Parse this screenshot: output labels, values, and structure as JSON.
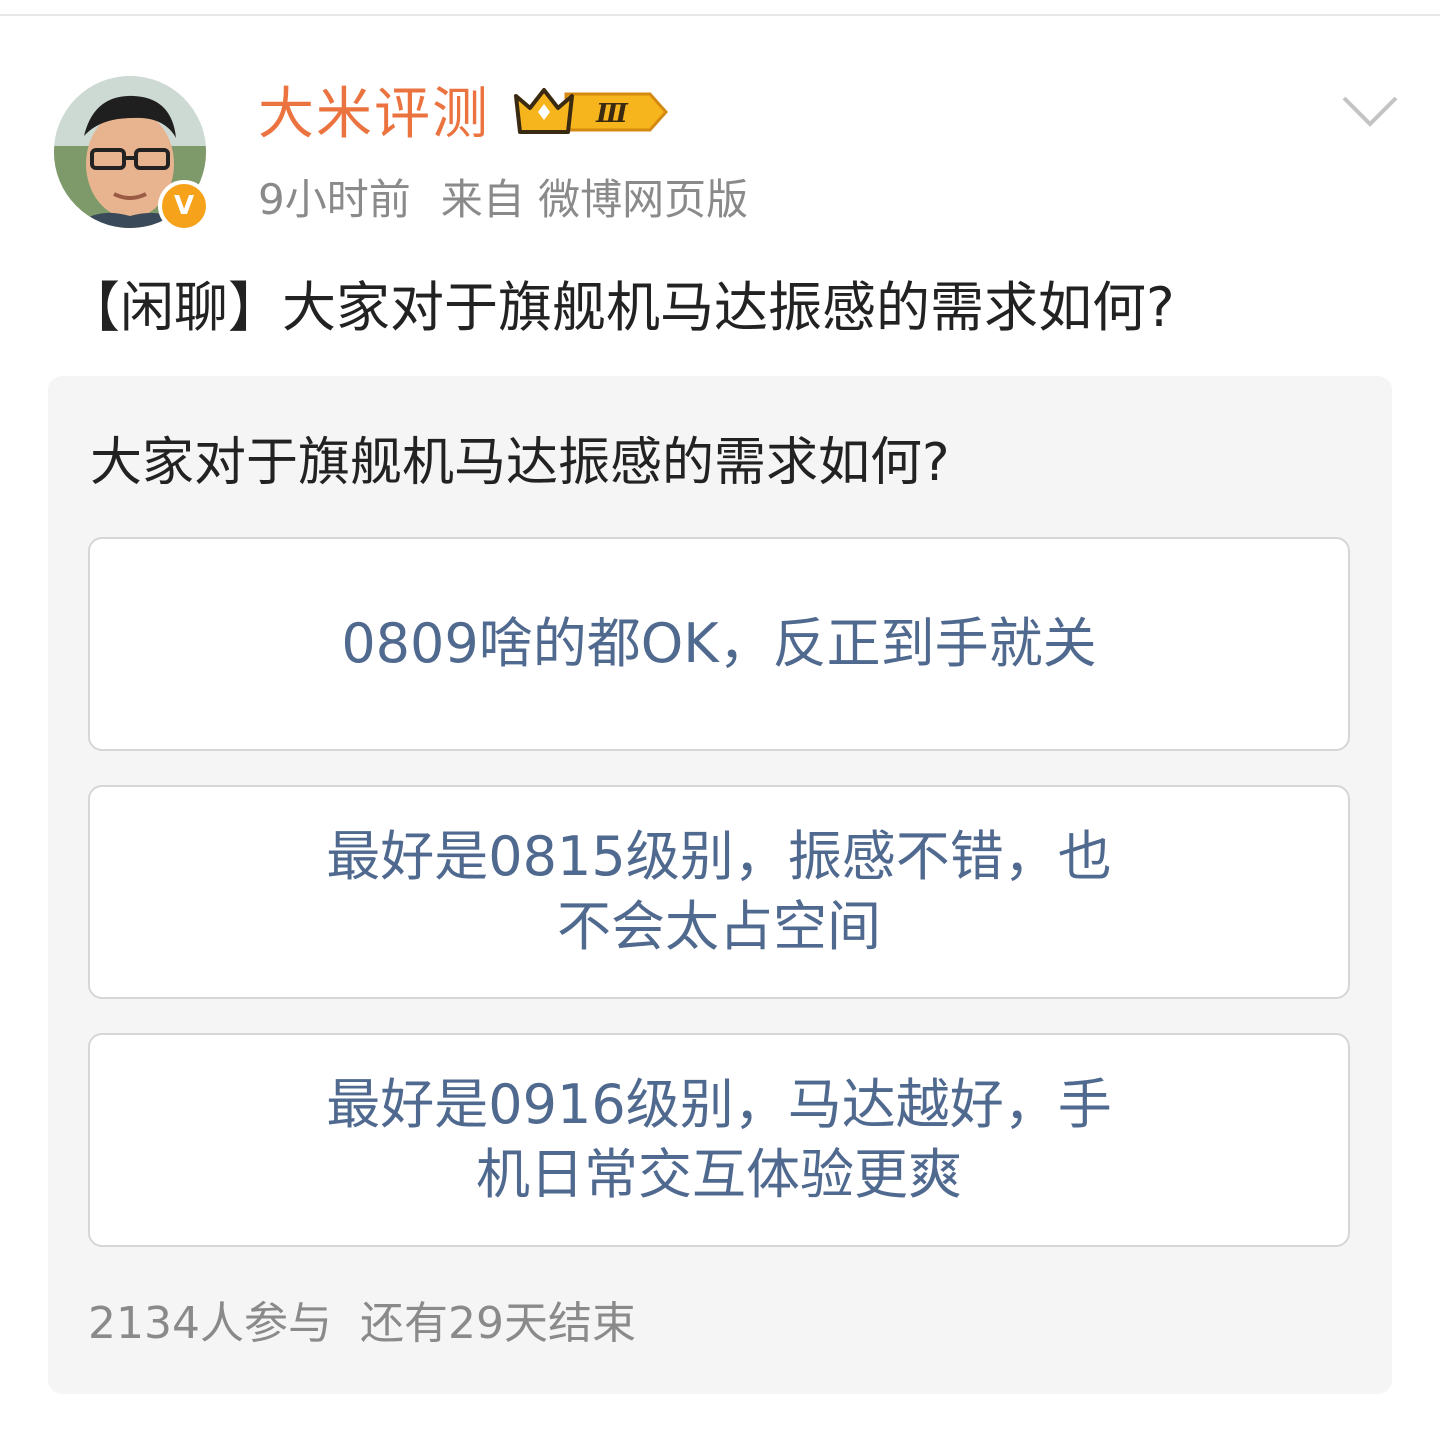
{
  "post": {
    "username": "大米评测",
    "badge_level": "Ⅲ",
    "time_ago": "9小时前",
    "source": "来自 微博网页版",
    "text": "【闲聊】大家对于旗舰机马达振感的需求如何?"
  },
  "poll": {
    "title": "大家对于旗舰机马达振感的需求如何?",
    "options": [
      {
        "label": "0809啥的都OK，反正到手就关"
      },
      {
        "label_line1": "最好是0815级别，振感不错，也",
        "label_line2": "不会太占空间"
      },
      {
        "label_line1": "最好是0916级别，马达越好，手",
        "label_line2": "机日常交互体验更爽"
      }
    ],
    "participants": "2134人参与",
    "remaining": "还有29天结束"
  },
  "colors": {
    "username": "#eb7340",
    "option_text": "#50698f",
    "meta_text": "#8a8a8a",
    "card_bg": "#f5f5f5",
    "verified": "#f7a21b"
  },
  "icons": [
    "avatar",
    "verified-v-icon",
    "crown-badge-icon",
    "chevron-down-icon"
  ]
}
